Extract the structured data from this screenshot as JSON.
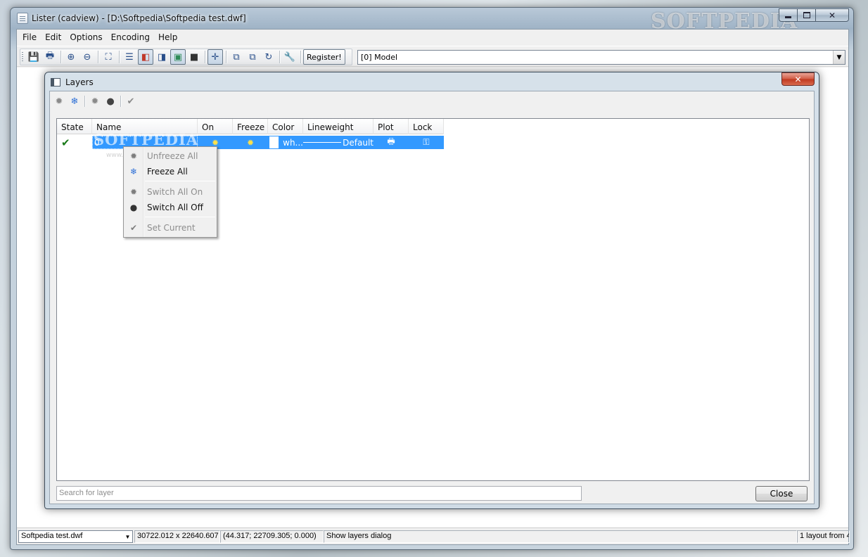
{
  "window": {
    "title": "Lister (cadview) - [D:\\Softpedia\\Softpedia test.dwf]",
    "watermark": "SOFTPEDIA",
    "minimize": "",
    "maximize": "",
    "close": "✕"
  },
  "menu": [
    "File",
    "Edit",
    "Options",
    "Encoding",
    "Help"
  ],
  "toolbar": {
    "register_label": "Register!",
    "layout_select_value": "[0] Model"
  },
  "status": {
    "file": "Softpedia test.dwf",
    "size": "30722.012 x 22640.607",
    "coords": "(44.317; 22709.305; 0.000)",
    "message": "Show layers dialog",
    "layouts": "1 layout from 4"
  },
  "layers_dialog": {
    "title": "Layers",
    "close_x": "✕",
    "columns": [
      "State",
      "Name",
      "On",
      "Freeze",
      "Color",
      "Lineweight",
      "Plot",
      "Lock"
    ],
    "row": {
      "state": "✔",
      "name": "0",
      "color_text": "wh...",
      "lineweight": "Default"
    },
    "row_watermark": "SOFTPEDIA",
    "search_placeholder": "Search for layer",
    "close_label": "Close"
  },
  "context_menu": {
    "items": [
      {
        "label": "Unfreeze All",
        "icon": "sun-icon",
        "enabled": false
      },
      {
        "label": "Freeze All",
        "icon": "snowflake-icon",
        "enabled": true
      },
      {
        "label": "Switch All On",
        "icon": "bulb-on-icon",
        "enabled": false
      },
      {
        "label": "Switch All Off",
        "icon": "bulb-off-icon",
        "enabled": true
      },
      {
        "label": "Set Current",
        "icon": "checkmark-icon",
        "enabled": false
      }
    ],
    "watermark": "www.softpedia.com"
  },
  "colors": {
    "selection": "#3399ff",
    "window_frame": "#b9c9d8",
    "state_check": "#1a7a1a"
  }
}
